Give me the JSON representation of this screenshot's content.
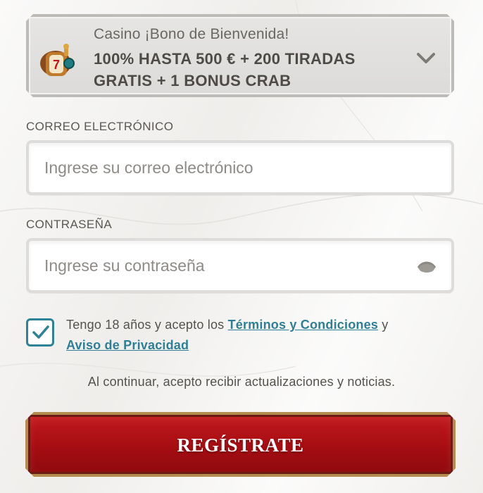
{
  "bonus": {
    "title": "Casino ¡Bono de Bienvenida!",
    "headline": "100% HASTA 500 € + 200 TIRADAS GRATIS + 1 BONUS CRAB",
    "icon": "slot-reel-icon",
    "toggle_icon": "chevron-down-icon"
  },
  "email": {
    "label": "CORREO ELECTRÓNICO",
    "placeholder": "Ingrese su correo electrónico",
    "value": ""
  },
  "password": {
    "label": "CONTRASEÑA",
    "placeholder": "Ingrese su contraseña",
    "value": "",
    "toggle_icon": "eye-icon"
  },
  "consent": {
    "checked": true,
    "text_before": "Tengo 18 años y acepto los ",
    "terms_link": "Términos y Condiciones",
    "text_middle": " y",
    "privacy_link": "Aviso de Privacidad"
  },
  "notice": "Al continuar, acepto recibir actualizaciones y noticias.",
  "register_button": "REGÍSTRATE",
  "colors": {
    "accent_teal": "#2d8296",
    "button_red": "#a50d12",
    "button_border_gold": "#b48c50"
  }
}
